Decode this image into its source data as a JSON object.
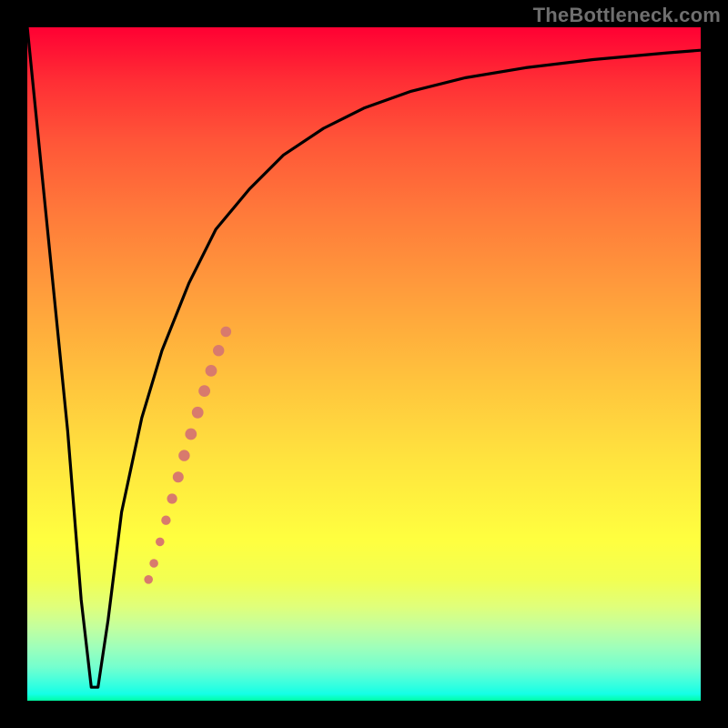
{
  "watermark": "TheBottleneck.com",
  "chart_data": {
    "type": "line",
    "title": "",
    "xlabel": "",
    "ylabel": "",
    "xlim": [
      0,
      100
    ],
    "ylim": [
      0,
      100
    ],
    "background_gradient_stops": [
      {
        "pos": 0.0,
        "color": "#ff0033"
      },
      {
        "pos": 0.5,
        "color": "#ffc23d"
      },
      {
        "pos": 0.8,
        "color": "#ffff3f"
      },
      {
        "pos": 1.0,
        "color": "#00ffa5"
      }
    ],
    "series": [
      {
        "name": "bottleneck-curve",
        "color": "#000000",
        "x": [
          0,
          3,
          6,
          8,
          9.5,
          10.5,
          12,
          14,
          17,
          20,
          24,
          28,
          33,
          38,
          44,
          50,
          57,
          65,
          74,
          84,
          95,
          100
        ],
        "y": [
          100,
          70,
          40,
          15,
          2,
          2,
          12,
          28,
          42,
          52,
          62,
          70,
          76,
          81,
          85,
          88,
          90.5,
          92.5,
          94,
          95.2,
          96.2,
          96.6
        ]
      },
      {
        "name": "highlight-dots",
        "type": "scatter",
        "color": "#d87a6d",
        "points": [
          {
            "x": 18.0,
            "y": 18.0,
            "r": 4.8
          },
          {
            "x": 18.8,
            "y": 20.4,
            "r": 4.8
          },
          {
            "x": 19.7,
            "y": 23.6,
            "r": 4.8
          },
          {
            "x": 20.6,
            "y": 26.8,
            "r": 5.2
          },
          {
            "x": 21.5,
            "y": 30.0,
            "r": 5.6
          },
          {
            "x": 22.4,
            "y": 33.2,
            "r": 6.0
          },
          {
            "x": 23.3,
            "y": 36.4,
            "r": 6.2
          },
          {
            "x": 24.3,
            "y": 39.6,
            "r": 6.4
          },
          {
            "x": 25.3,
            "y": 42.8,
            "r": 6.4
          },
          {
            "x": 26.3,
            "y": 46.0,
            "r": 6.4
          },
          {
            "x": 27.3,
            "y": 49.0,
            "r": 6.4
          },
          {
            "x": 28.4,
            "y": 52.0,
            "r": 6.2
          },
          {
            "x": 29.5,
            "y": 54.8,
            "r": 5.8
          }
        ]
      }
    ]
  }
}
